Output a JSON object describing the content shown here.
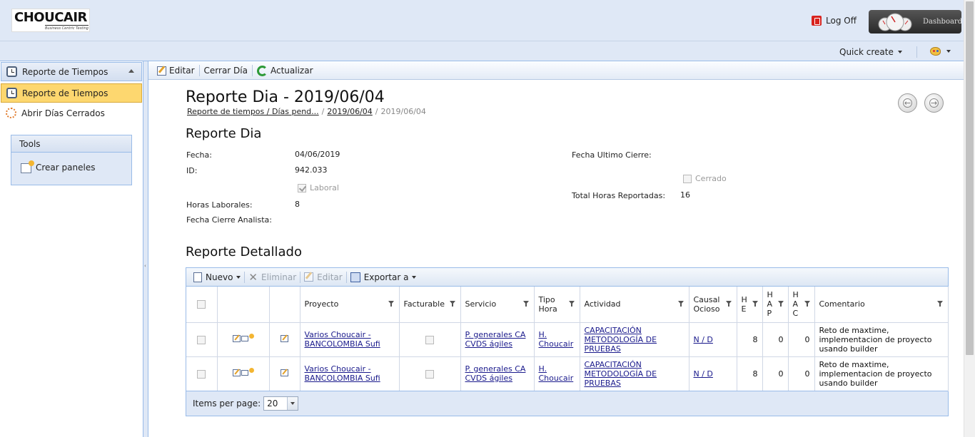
{
  "header": {
    "logo_text": "CHOUCAIR",
    "logo_tagline": "Business Centric Testing",
    "logoff_label": "Log Off",
    "dashboard_label": "Dashboard",
    "quick_create_label": "Quick create"
  },
  "sidebar": {
    "group_title": "Reporte de Tiempos",
    "items": [
      {
        "label": "Reporte de Tiempos",
        "icon": "clock-icon",
        "active": true
      },
      {
        "label": "Abrir Días Cerrados",
        "icon": "gear-sun-icon",
        "active": false
      }
    ],
    "tools_title": "Tools",
    "tools_items": [
      {
        "label": "Crear paneles",
        "icon": "panel-icon"
      }
    ]
  },
  "toolbar": {
    "edit_label": "Editar",
    "close_day_label": "Cerrar Día",
    "refresh_label": "Actualizar"
  },
  "page": {
    "title": "Reporte Dia - 2019/06/04",
    "breadcrumb": [
      {
        "label": "Reporte de tiempos / Días pend...",
        "link": true
      },
      {
        "label": "2019/06/04",
        "link": true
      },
      {
        "label": "2019/06/04",
        "link": false
      }
    ],
    "breadcrumb_sep": "/"
  },
  "reporte_dia": {
    "section_title": "Reporte Dia",
    "fecha_label": "Fecha:",
    "fecha_value": "04/06/2019",
    "id_label": "ID:",
    "id_value": "942.033",
    "laboral_label": "Laboral",
    "laboral_checked": true,
    "horas_laborales_label": "Horas Laborales:",
    "horas_laborales_value": "8",
    "fecha_cierre_analista_label": "Fecha Cierre Analista:",
    "fecha_ultimo_cierre_label": "Fecha Ultimo Cierre:",
    "cerrado_label": "Cerrado",
    "cerrado_checked": false,
    "total_horas_label": "Total Horas Reportadas:",
    "total_horas_value": "16"
  },
  "reporte_detallado": {
    "section_title": "Reporte Detallado",
    "toolbar": {
      "nuevo_label": "Nuevo",
      "eliminar_label": "Eliminar",
      "editar_label": "Editar",
      "exportar_label": "Exportar a"
    },
    "columns": {
      "proyecto": "Proyecto",
      "facturable": "Facturable",
      "servicio": "Servicio",
      "tipo_hora": "Tipo Hora",
      "actividad": "Actividad",
      "causal_ocioso": "Causal Ocioso",
      "he": "H E",
      "hap": "H A P",
      "hac": "H A C",
      "comentario": "Comentario"
    },
    "rows": [
      {
        "proyecto": "Varios Choucair - BANCOLOMBIA Sufi",
        "facturable": false,
        "servicio": "P. generales CA CVDS ágiles",
        "tipo_hora": "H. Choucair",
        "actividad": "CAPACITACIÓN METODOLOGÍA DE PRUEBAS",
        "causal_ocioso": "N / D",
        "he": "8",
        "hap": "0",
        "hac": "0",
        "comentario": "Reto de maxtime, implementacion de proyecto usando builder"
      },
      {
        "proyecto": "Varios Choucair - BANCOLOMBIA Sufi",
        "facturable": false,
        "servicio": "P. generales CA CVDS ágiles",
        "tipo_hora": "H. Choucair",
        "actividad": "CAPACITACIÓN METODOLOGÍA DE PRUEBAS",
        "causal_ocioso": "N / D",
        "he": "8",
        "hap": "0",
        "hac": "0",
        "comentario": "Reto de maxtime, implementacion de proyecto usando builder"
      }
    ],
    "pager": {
      "items_per_page_label": "Items per page:",
      "items_per_page_value": "20"
    }
  }
}
